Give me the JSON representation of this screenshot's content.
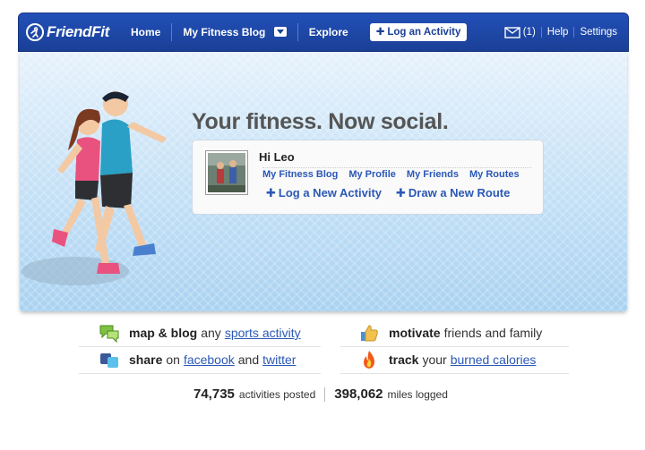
{
  "nav": {
    "logo": "FriendFit",
    "home": "Home",
    "blog": "My Fitness Blog",
    "explore": "Explore",
    "log_activity": "Log an Activity",
    "messages": "(1)",
    "help": "Help",
    "settings": "Settings"
  },
  "hero": {
    "headline": "Your fitness. Now social.",
    "greeting": "Hi Leo",
    "links": [
      "My Fitness Blog",
      "My Profile",
      "My Friends",
      "My Routes"
    ],
    "actions": [
      "Log a New Activity",
      "Draw a New Route"
    ]
  },
  "features": {
    "map_bold": "map & blog",
    "map_text": "any",
    "map_link": "sports activity",
    "motivate_bold": "motivate",
    "motivate_text": "friends and family",
    "share_bold": "share",
    "share_text1": "on",
    "share_link1": "facebook",
    "share_text2": "and",
    "share_link2": "twitter",
    "track_bold": "track",
    "track_text": "your",
    "track_link": "burned calories"
  },
  "stats": {
    "activities_num": "74,735",
    "activities_label": "activities posted",
    "miles_num": "398,062",
    "miles_label": "miles logged"
  }
}
